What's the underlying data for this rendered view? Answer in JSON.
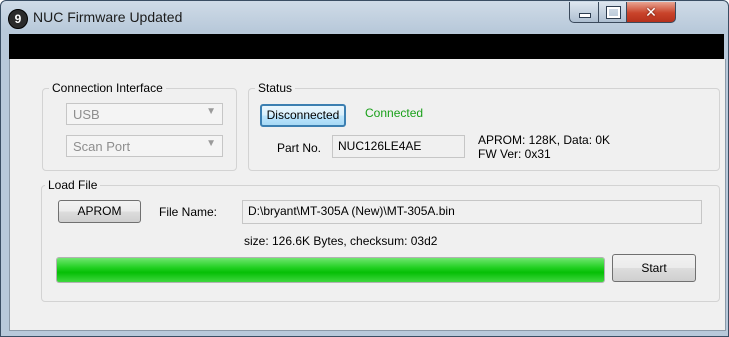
{
  "window": {
    "title": "NUC Firmware Updated",
    "app_icon_glyph": "9",
    "controls": {
      "minimize_icon": "minimize-icon",
      "maximize_icon": "maximize-icon",
      "close_icon": "close-icon",
      "close_glyph": "✕"
    }
  },
  "connection_interface": {
    "legend": "Connection Interface",
    "interface_value": "USB",
    "port_value": "Scan Port",
    "dropdown_glyph": "▼"
  },
  "status": {
    "legend": "Status",
    "disconnect_button": "Disconnected",
    "state_text": "Connected",
    "state_color": "#1aa01a",
    "part_no_label": "Part No.",
    "part_no_value": "NUC126LE4AE",
    "aprom_info": "APROM: 128K, Data: 0K",
    "fw_ver": "FW Ver: 0x31"
  },
  "load_file": {
    "legend": "Load File",
    "aprom_button": "APROM",
    "file_name_label": "File Name:",
    "file_path": "D:\\bryant\\MT-305A (New)\\MT-305A.bin",
    "size_info": "size: 126.6K Bytes, checksum: 03d2"
  },
  "progress": {
    "value_percent": 100,
    "color": "#22d022"
  },
  "start_button": "Start"
}
